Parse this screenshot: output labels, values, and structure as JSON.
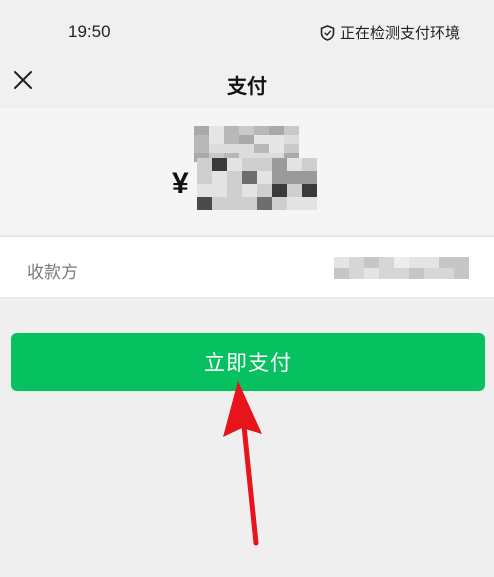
{
  "status_bar": {
    "time": "19:50",
    "env_text": "正在检测支付环境",
    "env_icon": "shield-icon"
  },
  "nav": {
    "title": "支付",
    "close_icon": "close-icon"
  },
  "amount": {
    "currency_symbol": "¥"
  },
  "payee": {
    "label": "收款方"
  },
  "pay_button": {
    "label": "立即支付",
    "color": "#07c160"
  },
  "annotation": {
    "arrow_color": "#e8141b",
    "arrow_icon": "red-arrow-up-icon"
  }
}
